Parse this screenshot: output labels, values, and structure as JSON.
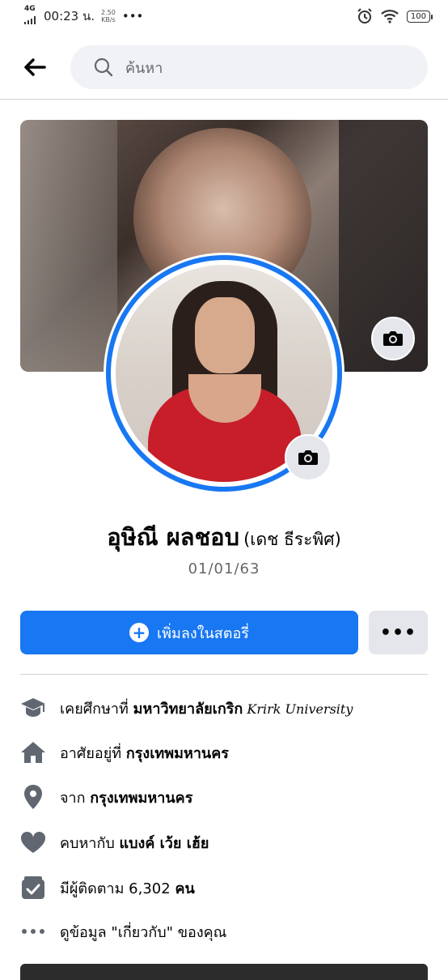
{
  "status_bar": {
    "network": "4G",
    "time": "00:23 น.",
    "speed_value": "2.50",
    "speed_unit": "KB/s",
    "dots": "•••",
    "battery": "100"
  },
  "search": {
    "placeholder": "ค้นหา"
  },
  "profile": {
    "name": "อุษิณี ผลชอบ",
    "alternate_name": "(เดช ธีระพิศ)",
    "date": "01/01/63"
  },
  "actions": {
    "add_story": "เพิ่มลงในสตอรี่",
    "more": "•••"
  },
  "info": [
    {
      "icon": "graduation-cap-icon",
      "prefix": "เคยศึกษาที่ ",
      "bold": "มหาวิทยาลัยเกริก",
      "extra": " Krirk University"
    },
    {
      "icon": "home-icon",
      "prefix": "อาศัยอยู่ที่ ",
      "bold": "กรุงเทพมหานคร",
      "extra": ""
    },
    {
      "icon": "location-pin-icon",
      "prefix": "จาก ",
      "bold": "กรุงเทพมหานคร",
      "extra": ""
    },
    {
      "icon": "heart-icon",
      "prefix": "คบหากับ ",
      "bold": "แบงค์ เว้ย เฮ้ย",
      "extra": ""
    },
    {
      "icon": "followers-icon",
      "prefix": "มีผู้ติดตาม 6,302 ",
      "bold": "คน",
      "extra": ""
    },
    {
      "icon": "more-dots-icon",
      "prefix": "ดูข้อมูล \"เกี่ยวกับ\" ของคุณ",
      "bold": "",
      "extra": ""
    }
  ],
  "colors": {
    "accent": "#1877f2",
    "icon_gray": "#606770"
  }
}
